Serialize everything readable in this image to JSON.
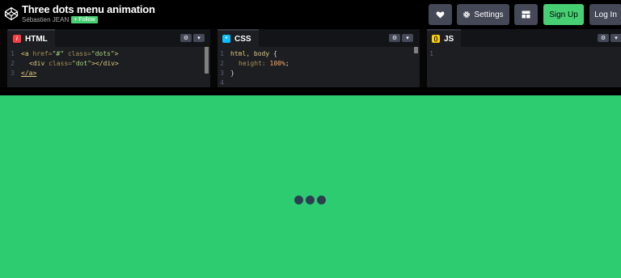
{
  "header": {
    "title": "Three dots menu animation",
    "author": "Sébastien JEAN",
    "follow_label": "+ Follow",
    "settings_label": "Settings",
    "signup_label": "Sign Up",
    "login_label": "Log In"
  },
  "editors": {
    "html": {
      "tab_label": "HTML",
      "badge_color": "#ff3c41",
      "lines": [
        "1",
        "2",
        "3"
      ]
    },
    "css": {
      "tab_label": "CSS",
      "badge_color": "#0ebeff",
      "lines": [
        "1",
        "2",
        "3",
        "4"
      ]
    },
    "js": {
      "tab_label": "JS",
      "badge_color": "#fcd000",
      "lines": [
        "1"
      ]
    }
  },
  "code": {
    "html": {
      "l1": {
        "open": "<a",
        "attr1": "href=",
        "val1": "\"#\"",
        "attr2": "class=",
        "val2": "\"dots\"",
        "close": ">"
      },
      "l2": {
        "open": "<div",
        "attr": "class=",
        "val": "\"dot\"",
        "close": "></div>"
      },
      "l3": {
        "text": "</a>"
      }
    },
    "css": {
      "l1": {
        "selector": "html, body",
        "brace": " {"
      },
      "l2": {
        "prop": "height:",
        "value": "100%",
        "semi": ";"
      },
      "l3": {
        "text": "}"
      }
    }
  },
  "preview": {
    "background": "#2ecc71",
    "dot_color": "#2c3e50",
    "dot_count": 3
  },
  "icons": {
    "logo": "codepen-logo-icon",
    "heart": "heart-icon",
    "settings": "gear-icon",
    "layout": "layout-grid-icon",
    "chevron": "chevron-down-icon"
  }
}
